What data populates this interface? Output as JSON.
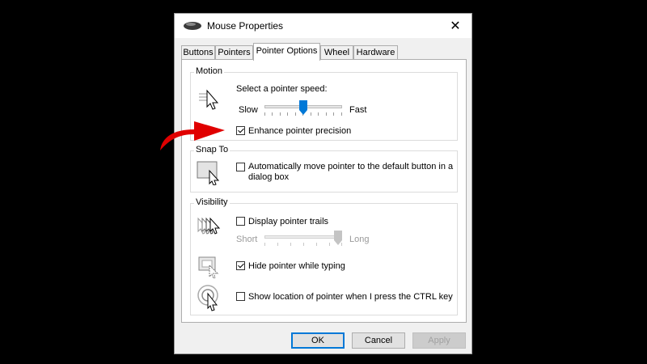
{
  "window": {
    "title": "Mouse Properties",
    "close_glyph": "✕"
  },
  "tabs": [
    {
      "label": "Buttons",
      "active": false
    },
    {
      "label": "Pointers",
      "active": false
    },
    {
      "label": "Pointer Options",
      "active": true
    },
    {
      "label": "Wheel",
      "active": false
    },
    {
      "label": "Hardware",
      "active": false
    }
  ],
  "motion": {
    "group_label": "Motion",
    "speed_label": "Select a pointer speed:",
    "slow_label": "Slow",
    "fast_label": "Fast",
    "speed_level": 0.5,
    "enhance_label": "Enhance pointer precision",
    "enhance_checked": true
  },
  "snap_to": {
    "group_label": "Snap To",
    "snap_label_line1": "Automatically move pointer to the default button in a",
    "snap_label_line2": "dialog box",
    "snap_checked": false
  },
  "visibility": {
    "group_label": "Visibility",
    "trails_label": "Display pointer trails",
    "trails_checked": false,
    "short_label": "Short",
    "long_label": "Long",
    "trails_level": 1.0,
    "hide_label": "Hide pointer while typing",
    "hide_checked": true,
    "show_location_label": "Show location of pointer when I press the CTRL key",
    "show_location_checked": false
  },
  "buttons": {
    "ok": "OK",
    "cancel": "Cancel",
    "apply": "Apply"
  },
  "colors": {
    "accent": "#0078d7",
    "annotation_arrow": "#e00000"
  }
}
